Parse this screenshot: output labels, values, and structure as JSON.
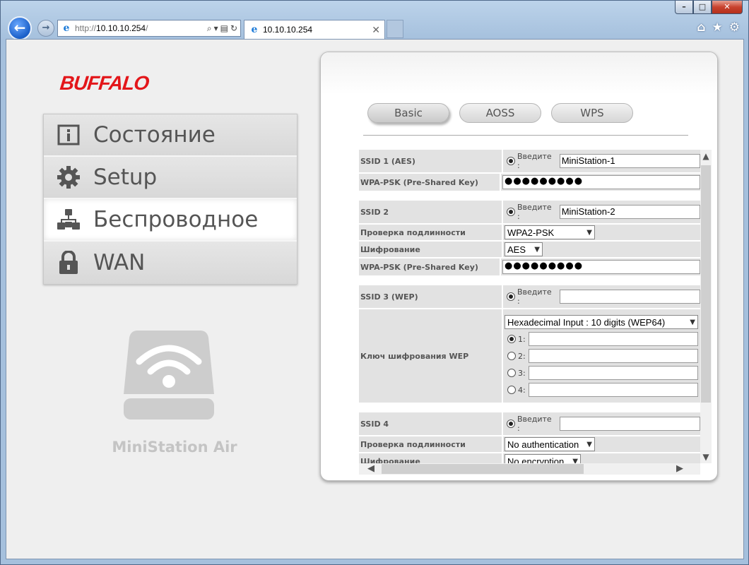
{
  "browser": {
    "url_protocol": "http://",
    "url_host": "10.10.10.254",
    "url_path": "/",
    "tab_title": "10.10.10.254",
    "win_min": "–",
    "win_max": "□",
    "win_close": "✕",
    "back": "←",
    "forward": "→",
    "search": "⌕",
    "refresh": "↻",
    "tab_close": "✕",
    "home": "⌂",
    "favorites": "★",
    "settings": "⚙"
  },
  "brand": {
    "logo": "BUFFALO",
    "device_name": "MiniStation Air"
  },
  "menu": {
    "items": [
      {
        "label": "Состояние",
        "icon": "info-icon"
      },
      {
        "label": "Setup",
        "icon": "gear-icon"
      },
      {
        "label": "Беспроводное",
        "icon": "wireless-network-icon",
        "active": true
      },
      {
        "label": "WAN",
        "icon": "lock-icon"
      }
    ]
  },
  "tabs": [
    {
      "label": "Basic",
      "active": true
    },
    {
      "label": "AOSS"
    },
    {
      "label": "WPS"
    }
  ],
  "form": {
    "enter_label": "Введите :",
    "ssid1": {
      "label": "SSID 1 (AES)",
      "value": "MiniStation-1",
      "psk_label": "WPA-PSK (Pre-Shared Key)",
      "psk": "●●●●●●●●●"
    },
    "ssid2": {
      "label": "SSID 2",
      "value": "MiniStation-2",
      "auth_label": "Проверка подлинности",
      "auth": "WPA2-PSK",
      "enc_label": "Шифрование",
      "enc": "AES",
      "psk_label": "WPA-PSK (Pre-Shared Key)",
      "psk": "●●●●●●●●●"
    },
    "ssid3": {
      "label": "SSID 3 (WEP)",
      "value": "",
      "wep_label": "Ключ шифрования WEP",
      "wep_type": "Hexadecimal Input : 10 digits (WEP64)",
      "keys": [
        "1:",
        "2:",
        "3:",
        "4:"
      ]
    },
    "ssid4": {
      "label": "SSID 4",
      "value": "",
      "auth_label": "Проверка подлинности",
      "auth": "No authentication",
      "enc_label": "Шифрование",
      "enc": "No encryption"
    }
  },
  "colors": {
    "brand_red": "#e3161a",
    "panel_bg": "#ffffff",
    "label_bg": "#e2e2e2"
  }
}
